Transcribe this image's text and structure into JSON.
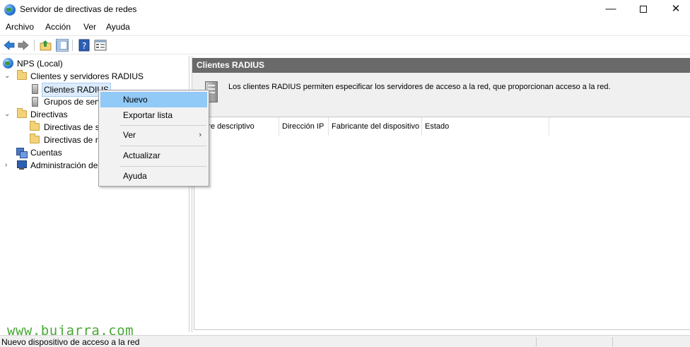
{
  "window": {
    "title": "Servidor de directivas de redes",
    "minimize_glyph": "—",
    "close_glyph": "✕"
  },
  "menu": {
    "items": [
      {
        "label": "Archivo"
      },
      {
        "label": "Acción"
      },
      {
        "label": "Ver"
      },
      {
        "label": "Ayuda"
      }
    ]
  },
  "toolbar": {
    "icons": [
      "back-arrow-icon",
      "forward-arrow-icon",
      "up-folder-icon",
      "show-hide-tree-icon",
      "help-icon",
      "properties-icon"
    ]
  },
  "tree": {
    "root": "NPS (Local)",
    "radius_group": "Clientes y servidores RADIUS",
    "radius_clients": "Clientes RADIUS",
    "remote_groups": "Grupos de serv",
    "policies": "Directivas",
    "policy_a": "Directivas de s",
    "policy_b": "Directivas de re",
    "accounting": "Cuentas",
    "admin": "Administración de",
    "expanded_glyph": "⌄",
    "collapsed_glyph": "›"
  },
  "right_pane": {
    "header": "Clientes RADIUS",
    "description": "Los clientes RADIUS permiten especificar los servidores de acceso a la red, que proporcionan acceso a la red.",
    "columns": [
      "mbre descriptivo",
      "Dirección IP",
      "Fabricante del dispositivo",
      "Estado"
    ]
  },
  "context_menu": {
    "items": [
      {
        "label": "Nuevo",
        "highlighted": true
      },
      {
        "label": "Exportar lista"
      },
      {
        "label": "Ver",
        "submenu": true,
        "arrow": "›"
      },
      {
        "label": "Actualizar"
      },
      {
        "label": "Ayuda"
      }
    ]
  },
  "watermark": "www.bujarra.com",
  "statusbar": {
    "text": "Nuevo dispositivo de acceso a la red"
  },
  "colors": {
    "header_bg": "#6a6a6a",
    "highlight": "#91c9f7",
    "watermark": "#49a835"
  }
}
